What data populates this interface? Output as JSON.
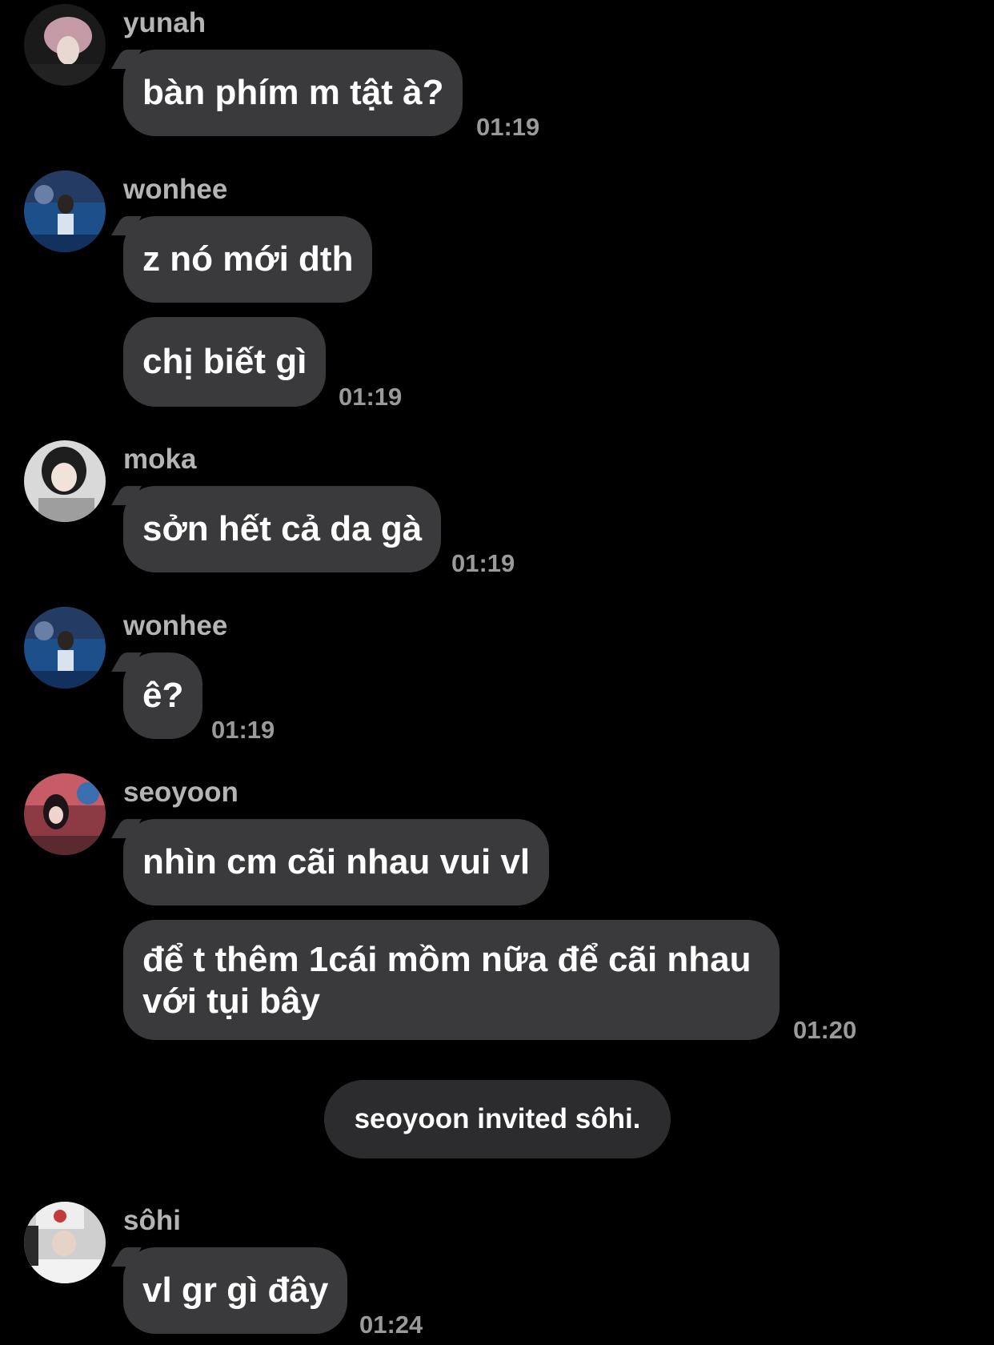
{
  "messages": [
    {
      "sender": "yunah",
      "avatar_icon": "avatar-yunah",
      "text": "bàn phím m tật à?",
      "time": "01:19"
    },
    {
      "sender": "wonhee",
      "avatar_icon": "avatar-wonhee",
      "text": "z nó mới dth"
    },
    {
      "text": "chị biết gì",
      "time": "01:19"
    },
    {
      "sender": "moka",
      "avatar_icon": "avatar-moka",
      "text": "sởn hết cả da gà",
      "time": "01:19"
    },
    {
      "sender": "wonhee",
      "avatar_icon": "avatar-wonhee",
      "text": "ê?",
      "time": "01:19"
    },
    {
      "sender": "seoyoon",
      "avatar_icon": "avatar-seoyoon",
      "text": "nhìn cm cãi nhau vui vl"
    },
    {
      "text": "để t thêm 1cái mồm nữa để cãi nhau với tụi bây",
      "time": "01:20"
    },
    {
      "system": "seoyoon invited sôhi."
    },
    {
      "sender": "sôhi",
      "avatar_icon": "avatar-sohi",
      "text": "vl gr gì đây",
      "time": "01:24"
    }
  ],
  "colors": {
    "background": "#000000",
    "bubble": "#3a3a3c",
    "system_pill": "#2c2c2e",
    "sender_name": "#b4b4b4",
    "timestamp": "#9a9a9a",
    "text": "#ffffff"
  }
}
